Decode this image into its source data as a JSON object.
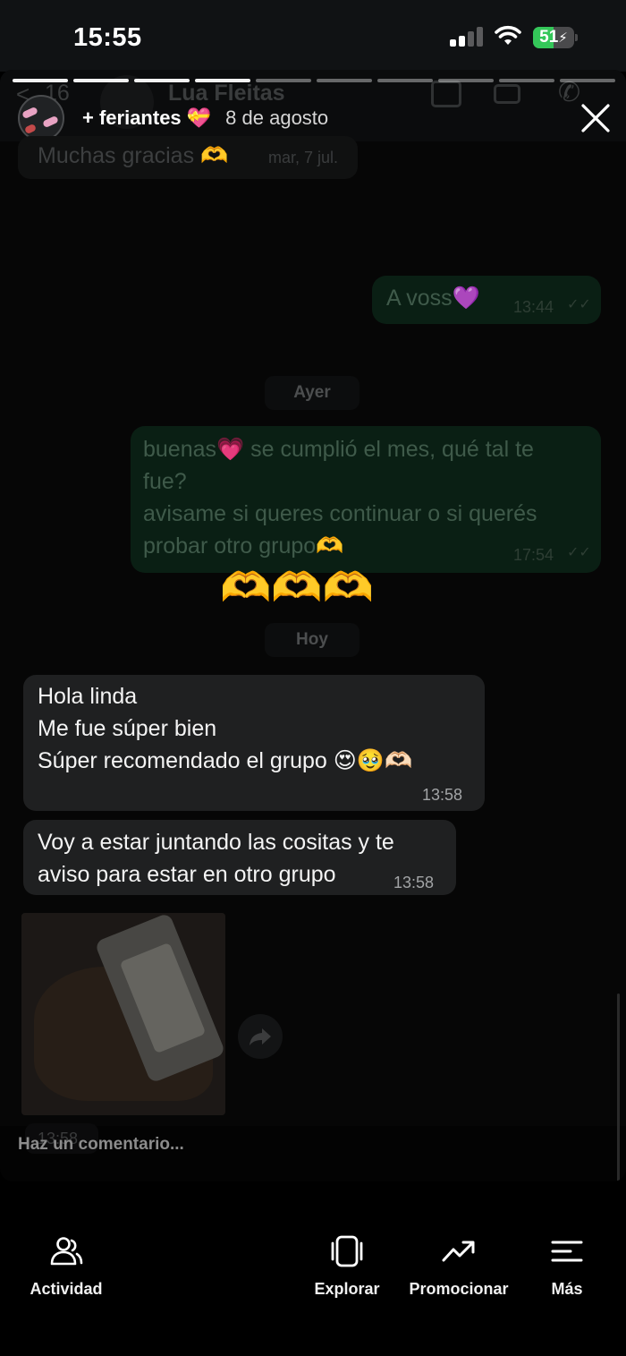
{
  "status_bar": {
    "time": "15:55",
    "battery_percent": "51",
    "battery_level": 0.51
  },
  "story": {
    "author": "+ feriantes 💝",
    "date": "8 de agosto",
    "segments": 10,
    "current_segment": 4,
    "comment_placeholder": "Haz un comentario..."
  },
  "chat": {
    "header": {
      "back_count": "16",
      "contact_name": "Lua Fleitas"
    },
    "messages": [
      {
        "direction": "in",
        "text": "Muchas gracias 🫶",
        "time": "mar, 7 jul."
      },
      {
        "direction": "out",
        "text": "A voss💜",
        "time": "13:44"
      },
      {
        "type": "day",
        "text": "Ayer"
      },
      {
        "direction": "out",
        "lines": [
          "buenas💗 se cumplió el mes, qué tal te",
          "fue?",
          "avisame si queres continuar o si querés",
          "probar otro grupo🫶"
        ],
        "time": "17:54"
      },
      {
        "type": "sticker",
        "text": "🫶🫶🫶"
      },
      {
        "type": "day",
        "text": "Hoy"
      },
      {
        "direction": "in",
        "lines": [
          "Hola linda",
          "Me fue súper bien",
          "Súper recomendado el grupo 😍🥹🫶🏻"
        ],
        "time": "13:58"
      },
      {
        "direction": "in",
        "lines": [
          "Voy a estar juntando las cositas y te",
          "aviso para estar en otro grupo"
        ],
        "time": "13:58"
      },
      {
        "direction": "in",
        "type": "image",
        "time": "13:58"
      }
    ]
  },
  "bottom_nav": [
    {
      "label": "Actividad",
      "icon": "people-icon"
    },
    {
      "label": "Explorar",
      "icon": "phone-frame-icon"
    },
    {
      "label": "Promocionar",
      "icon": "trending-up-icon"
    },
    {
      "label": "Más",
      "icon": "menu-lines-icon"
    }
  ]
}
